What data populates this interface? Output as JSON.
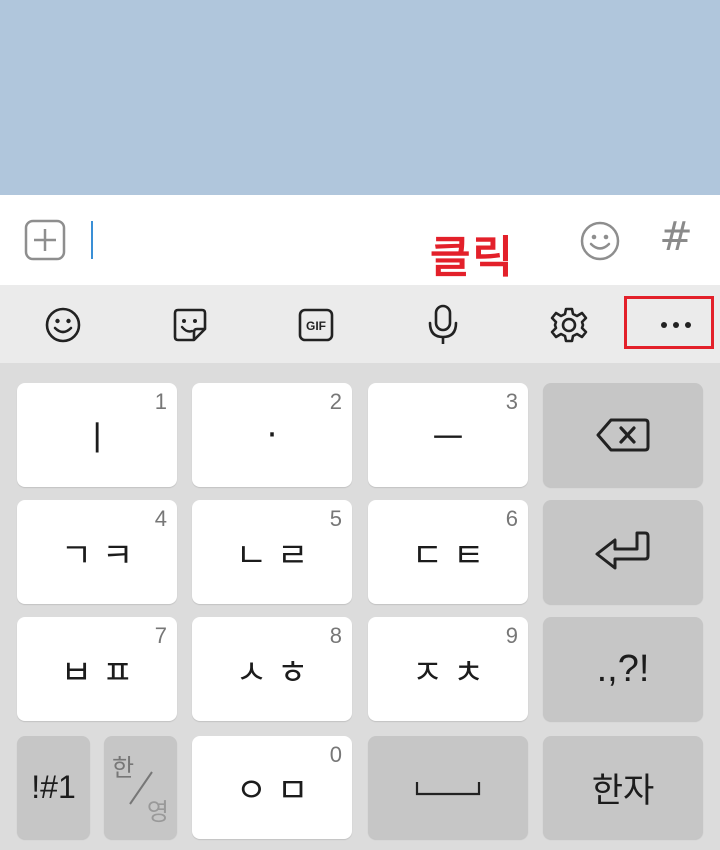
{
  "input_bar": {
    "hash_label": "#"
  },
  "annotation": {
    "click_label": "클릭"
  },
  "toolbar": {
    "items": [
      "emoji-icon",
      "sticker-icon",
      "gif-icon",
      "microphone-icon",
      "gear-icon",
      "more-icon"
    ],
    "gif_text": "GIF",
    "more_label": "•••"
  },
  "keyboard": {
    "row1": [
      {
        "label": "ㅣ",
        "num": "1"
      },
      {
        "label": "·",
        "num": "2"
      },
      {
        "label": "ㅡ",
        "num": "3"
      }
    ],
    "row2": [
      {
        "label": "ㄱㅋ",
        "num": "4"
      },
      {
        "label": "ㄴㄹ",
        "num": "5"
      },
      {
        "label": "ㄷㅌ",
        "num": "6"
      }
    ],
    "row3": [
      {
        "label": "ㅂㅍ",
        "num": "7"
      },
      {
        "label": "ㅅㅎ",
        "num": "8"
      },
      {
        "label": "ㅈㅊ",
        "num": "9"
      }
    ],
    "punct_label": ".,?!",
    "row4": {
      "symbols_label": "!#1",
      "lang_top": "한",
      "lang_bottom": "영",
      "zero_label": "ㅇㅁ",
      "zero_num": "0",
      "hanja_label": "한자"
    }
  },
  "colors": {
    "chat_background": "#b0c6dc",
    "highlight": "#e3202a",
    "caret": "#3a8fd6"
  }
}
